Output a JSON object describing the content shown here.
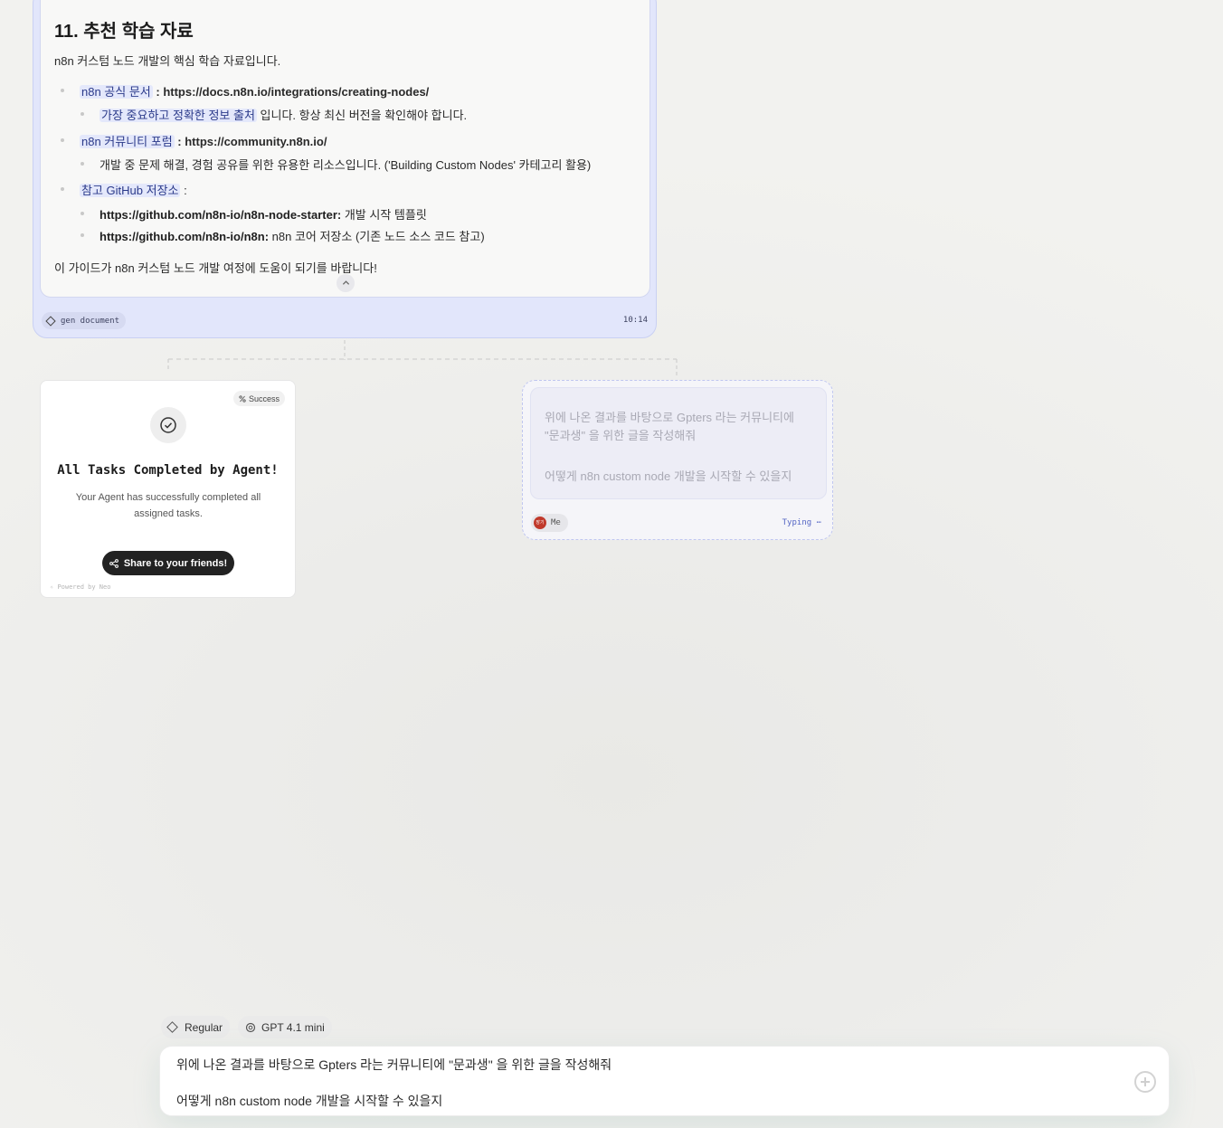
{
  "document_node": {
    "heading": "11. 추천 학습 자료",
    "intro": "n8n 커스텀 노드 개발의 핵심 학습 자료입니다.",
    "items": [
      {
        "label": "n8n 공식 문서",
        "text": " : https://docs.n8n.io/integrations/creating-nodes/",
        "sub": [
          {
            "highlight": "가장 중요하고 정확한 정보 출처",
            "text": " 입니다. 항상 최신 버전을 확인해야 합니다."
          }
        ]
      },
      {
        "label": "n8n 커뮤니티 포럼",
        "text": " : https://community.n8n.io/",
        "sub": [
          {
            "highlight": "",
            "text": "개발 중 문제 해결, 경험 공유를 위한 유용한 리소스입니다. ('Building Custom Nodes' 카테고리 활용)"
          }
        ]
      },
      {
        "label": "참고 GitHub 저장소",
        "text": " :",
        "sub": [
          {
            "bold": "https://github.com/n8n-io/n8n-node-starter:",
            "text": " 개발 시작 템플릿"
          },
          {
            "bold": "https://github.com/n8n-io/n8n:",
            "text": " n8n 코어 저장소 (기존 노드 소스 코드 참고)"
          }
        ]
      }
    ],
    "closing": "이 가이드가 n8n 커스텀 노드 개발 여정에 도움이 되기를 바랍니다!",
    "collapse_icon": "chevron-up-icon",
    "tag_label": "gen document",
    "time": "10:14"
  },
  "success_card": {
    "badge": "Success",
    "title": "All Tasks Completed by Agent!",
    "description": "Your Agent has successfully completed all assigned tasks.",
    "share_label": "Share to your friends!",
    "powered_by": "Powered by Neo"
  },
  "pending_node": {
    "line1": "위에 나온 결과를 바탕으로 Gpters 라는 커뮤니티에",
    "line2": "\"문과생\" 을 위한 글을 작성해줘",
    "line3": "어떻게 n8n custom node 개발을 시작할 수 있을지",
    "avatar_text": "장기",
    "author": "Me",
    "status": "Typing ⋯"
  },
  "composer": {
    "mode_label": "Regular",
    "model_label": "GPT 4.1 mini",
    "line1": "위에 나온 결과를 바탕으로 Gpters 라는 커뮤니티에 \"문과생\" 을 위한 글을 작성해줘",
    "line2": "어떻게 n8n custom node 개발을 시작할 수 있을지",
    "send_icon": "plus-circle-icon"
  },
  "colors": {
    "doc_node_bg": "#e2e6fb",
    "highlight_bg": "#e4e8fb",
    "typing_accent": "#5566c4",
    "share_button_bg": "#222222"
  }
}
